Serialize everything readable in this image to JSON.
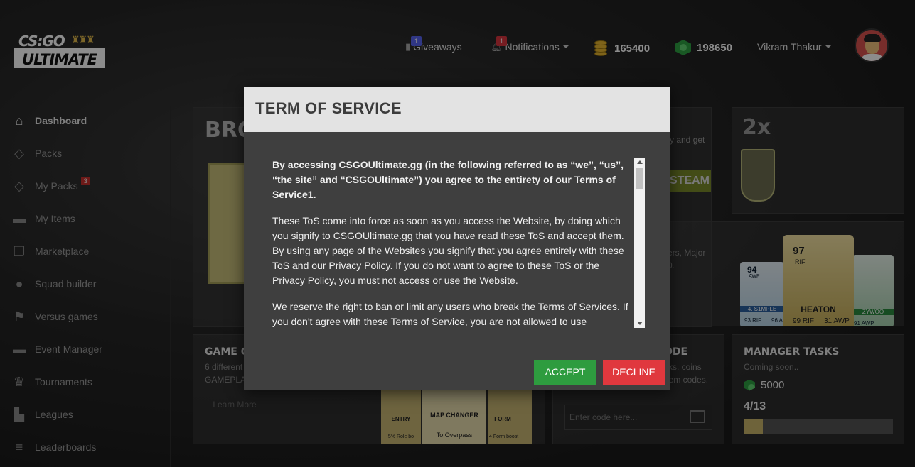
{
  "logo": {
    "top": "CS:GO",
    "bottom": "ULTIMATE"
  },
  "header": {
    "giveaways": {
      "label": "Giveaways",
      "badge": "1"
    },
    "notifications": {
      "label": "Notifications",
      "badge": "1"
    },
    "coins": "165400",
    "gems": "198650",
    "user_name": "Vikram Thakur"
  },
  "sidebar": {
    "items": [
      {
        "label": "Dashboard"
      },
      {
        "label": "Packs"
      },
      {
        "label": "My Packs",
        "badge": "3"
      },
      {
        "label": "My Items"
      },
      {
        "label": "Marketplace"
      },
      {
        "label": "Squad builder"
      },
      {
        "label": "Versus games"
      },
      {
        "label": "Event Manager"
      },
      {
        "label": "Tournaments"
      },
      {
        "label": "Leagues"
      },
      {
        "label": "Leaderboards"
      }
    ]
  },
  "panels": {
    "bro_title": "BRO",
    "bonus_mult": "2x",
    "bonus_text": "y and get",
    "steam": "STEAM",
    "players_text": "ers, Major",
    "players_text2": "0.",
    "game_modes": {
      "title": "GAME C",
      "sub1": "6 different",
      "sub2": "GAMEPLA",
      "button": "Learn More"
    },
    "cards": [
      {
        "top": "ENTRY",
        "bottom": "5% Role bo"
      },
      {
        "top": "MAP CHANGER",
        "bottom": "To Overpass"
      },
      {
        "top": "FORM",
        "bottom": "4 Form boost"
      }
    ],
    "code": {
      "title": "ODE",
      "sub1": "cks, coins",
      "sub2": "eem codes.",
      "placeholder": "Enter code here..."
    },
    "manager": {
      "title": "MANAGER TASKS",
      "sub": "Coming soon..",
      "gems": "5000",
      "progress_text": "4/13",
      "progress": 0.13
    }
  },
  "player_cards": [
    {
      "rating": "94",
      "role": "AWP",
      "name": "4. S1MPLE",
      "stat1": "93 RIF",
      "stat2": "96 A"
    },
    {
      "rating": "97",
      "role": "RIF",
      "name": "HEATON",
      "stat1": "99 RIF",
      "stat2": "31 AWP"
    },
    {
      "rating": "",
      "role": "",
      "name": "ZYWOO",
      "stat1": "91 AWP",
      "stat2": ""
    }
  ],
  "modal": {
    "title": "TERM OF SERVICE",
    "paragraphs": [
      "By accessing CSGOUltimate.gg (in the following referred to as “we”, “us”, “the site” and “CSGOUltimate”) you agree to the entirety of our Terms of Service1.",
      "These ToS come into force as soon as you access the Website, by doing which you signify to CSGOUltimate.gg that you have read these ToS and accept them. By using any page of the Websites you signify that you agree entirely with these ToS and our Privacy Policy. If you do not want to agree to these ToS or the Privacy Policy, you must not access or use the Website.",
      "We reserve the right to ban or limit any users who break the Terms of Services. If you don't agree with these Terms of Service, you are not allowed to use CSGOUltimate.gg."
    ],
    "accept": "ACCEPT",
    "decline": "DECLINE"
  },
  "colors": {
    "accept": "#2e9c3f",
    "decline": "#e0383e",
    "badge_blue": "#5865f2",
    "badge_red": "#d9363e"
  }
}
